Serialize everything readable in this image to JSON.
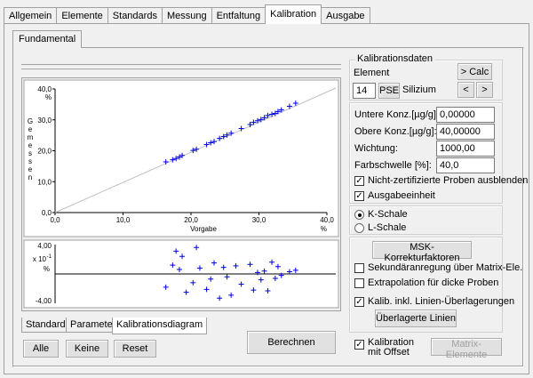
{
  "tabs": [
    "Allgemein",
    "Elemente",
    "Standards",
    "Messung",
    "Entfaltung",
    "Kalibration",
    "Ausgabe"
  ],
  "active_tab": "Kalibration",
  "subtab": "Fundamental",
  "bottom_tabs": [
    "Standards",
    "Parameter",
    "Kalibrationsdiagram"
  ],
  "active_bottom_tab": "Kalibrationsdiagram",
  "buttons": {
    "alle": "Alle",
    "keine": "Keine",
    "reset": "Reset",
    "berechnen": "Berechnen",
    "calc": "> Calc",
    "prev": "<",
    "next": ">",
    "pse": "PSE",
    "msk": "MSK-Korrekturfaktoren",
    "ueberlagerte": "Überlagerte Linien",
    "matrix": "Matrix-Elemente"
  },
  "kalibrationsdaten": {
    "legend": "Kalibrationsdaten",
    "element_label": "Element",
    "element_number": "14",
    "element_name": "Silizium"
  },
  "params": [
    {
      "label": "Untere Konz.[µg/g]:",
      "value": "0,00000"
    },
    {
      "label": "Obere Konz.[µg/g]:",
      "value": "40,00000"
    },
    {
      "label": "Wichtung:",
      "value": "1000,00"
    },
    {
      "label": "Farbschwelle [%]:",
      "value": "40,0"
    }
  ],
  "checks": {
    "nicht_zertifizierte": {
      "label": "Nicht-zertifizierte Proben ausblenden",
      "checked": true
    },
    "ausgabeeinheit": {
      "label": "Ausgabeeinheit",
      "checked": true
    },
    "sekundaer": {
      "label": "Sekundäranregung über Matrix-Ele.",
      "checked": false
    },
    "extrapolation": {
      "label": "Extrapolation für dicke Proben",
      "checked": false
    },
    "kalib_linien": {
      "label": "Kalib. inkl. Linien-Überlagerungen",
      "checked": true
    },
    "kalibration_offset": {
      "label": "Kalibration mit Offset",
      "checked": true
    }
  },
  "radios": {
    "k_schale": {
      "label": "K-Schale",
      "selected": true
    },
    "l_schale": {
      "label": "L-Schale",
      "selected": false
    }
  },
  "chart_data": [
    {
      "type": "scatter",
      "xlabel": "Vorgabe",
      "x_unit": "%",
      "ylabel": "Gemessen",
      "y_unit": "%",
      "xlim": [
        0,
        40
      ],
      "ylim": [
        0,
        40
      ],
      "x_ticks": [
        "0,0",
        "10,0",
        "20,0",
        "30,0",
        "40,0"
      ],
      "y_ticks": [
        "0,0",
        "10,0",
        "20,0",
        "30,0",
        "40,0"
      ],
      "reference_line": [
        [
          0,
          0
        ],
        [
          40,
          40
        ]
      ],
      "points": [
        [
          16.3,
          16.4
        ],
        [
          17.3,
          17.1
        ],
        [
          17.8,
          17.5
        ],
        [
          18.3,
          18.0
        ],
        [
          18.7,
          18.5
        ],
        [
          20.3,
          20.1
        ],
        [
          20.8,
          20.5
        ],
        [
          22.3,
          22.0
        ],
        [
          22.9,
          22.6
        ],
        [
          23.4,
          23.0
        ],
        [
          24.2,
          24.0
        ],
        [
          24.8,
          24.6
        ],
        [
          25.3,
          25.1
        ],
        [
          25.9,
          25.7
        ],
        [
          27.4,
          27.2
        ],
        [
          28.7,
          28.5
        ],
        [
          29.2,
          29.2
        ],
        [
          29.8,
          29.7
        ],
        [
          30.3,
          30.1
        ],
        [
          30.8,
          30.7
        ],
        [
          31.3,
          31.4
        ],
        [
          31.9,
          31.8
        ],
        [
          32.4,
          32.1
        ],
        [
          32.8,
          32.7
        ],
        [
          33.3,
          33.2
        ],
        [
          34.5,
          34.4
        ],
        [
          35.4,
          35.4
        ]
      ]
    },
    {
      "type": "scatter",
      "x_unit": "%",
      "y_unit": "%",
      "y_scale_label": "x 10",
      "y_scale_exp": "-1",
      "xlim": [
        0,
        40
      ],
      "ylim": [
        -4,
        4
      ],
      "y_ticks": [
        "4,00",
        "-4,00"
      ],
      "zero_line": true,
      "points": [
        [
          16.3,
          -1.8
        ],
        [
          17.3,
          1.2
        ],
        [
          17.8,
          3.1
        ],
        [
          18.3,
          0.6
        ],
        [
          18.7,
          2.4
        ],
        [
          19.3,
          -2.5
        ],
        [
          20.3,
          -1.2
        ],
        [
          20.8,
          3.6
        ],
        [
          21.3,
          0.8
        ],
        [
          22.3,
          -2.1
        ],
        [
          22.9,
          -0.7
        ],
        [
          23.4,
          1.5
        ],
        [
          24.2,
          -3.3
        ],
        [
          24.8,
          0.9
        ],
        [
          25.3,
          -0.4
        ],
        [
          25.9,
          -2.9
        ],
        [
          26.6,
          1.1
        ],
        [
          27.4,
          -1.4
        ],
        [
          28.7,
          1.3
        ],
        [
          29.2,
          -2.2
        ],
        [
          29.8,
          0.2
        ],
        [
          30.3,
          -0.8
        ],
        [
          30.8,
          0.4
        ],
        [
          31.3,
          -2.3
        ],
        [
          31.9,
          1.6
        ],
        [
          32.4,
          -0.6
        ],
        [
          32.8,
          1.0
        ],
        [
          33.3,
          -0.2
        ],
        [
          34.5,
          0.3
        ],
        [
          35.4,
          0.5
        ]
      ]
    }
  ]
}
